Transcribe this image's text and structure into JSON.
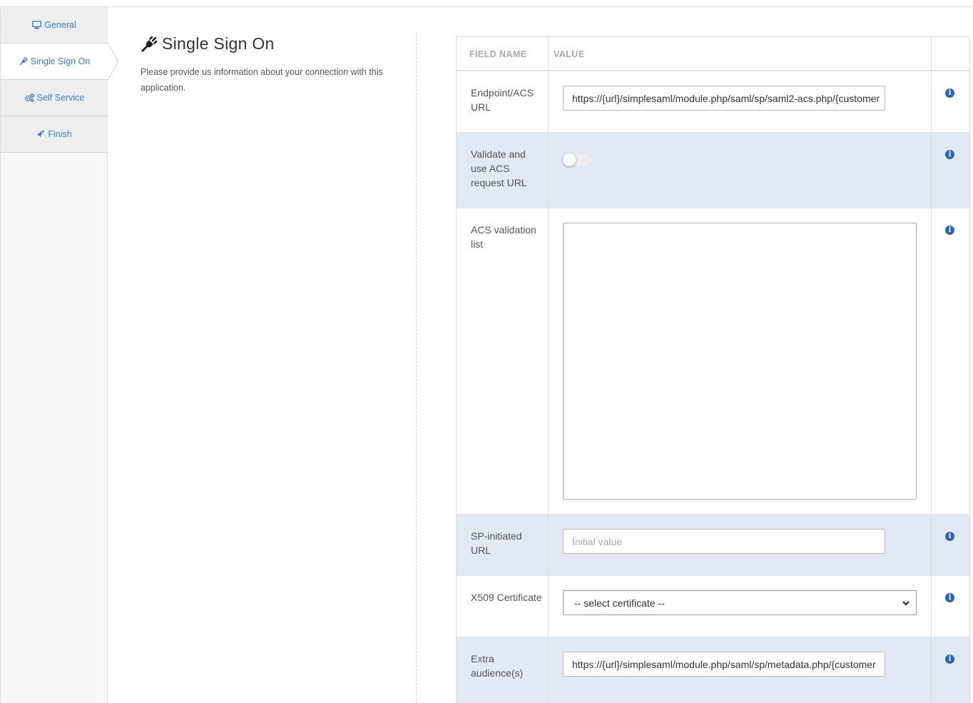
{
  "sidebar": {
    "tabs": [
      {
        "label": "General",
        "icon": "desktop-icon",
        "active": false
      },
      {
        "label": "Single Sign On",
        "icon": "plug-icon",
        "active": true
      },
      {
        "label": "Self Service",
        "icon": "cogs-icon",
        "active": false
      },
      {
        "label": "Finish",
        "icon": "rocket-icon",
        "active": false
      }
    ]
  },
  "section": {
    "icon": "plug-icon",
    "title": "Single Sign On",
    "description": "Please provide us information about your connection with this application."
  },
  "table": {
    "headers": {
      "field_name": "FIELD NAME",
      "value": "VALUE"
    },
    "rows": {
      "endpoint": {
        "label": "Endpoint/ACS URL",
        "value": "https://{url}/simplesaml/module.php/saml/sp/saml2-acs.php/{customer"
      },
      "validate": {
        "label": "Validate and use ACS request URL",
        "enabled": false
      },
      "acs_list": {
        "label": "ACS validation list",
        "value": ""
      },
      "sp_initiated": {
        "label": "SP-initiated URL",
        "value": "",
        "placeholder": "Initial value"
      },
      "x509": {
        "label": "X509 Certificate",
        "selected": "-- select certificate --"
      },
      "extra_audience": {
        "label": "Extra audience(s)",
        "value": "https://{url}/simplesaml/module.php/saml/sp/metadata.php/{customer"
      }
    },
    "info_icon": "info-icon"
  },
  "colors": {
    "accent": "#3a7bd5",
    "info": "#2d63b8",
    "alt_row": "#e3e9f2"
  }
}
